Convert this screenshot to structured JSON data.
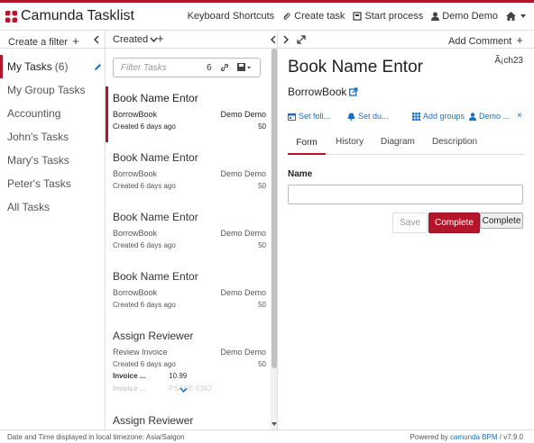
{
  "app": {
    "title": "Camunda Tasklist"
  },
  "nav": {
    "keyboard_shortcuts": "Keyboard Shortcuts",
    "create_task": "Create task",
    "start_process": "Start process",
    "user": "Demo Demo"
  },
  "filters": {
    "create_label": "Create a filter",
    "items": [
      {
        "label": "My Tasks",
        "count": "(6)"
      },
      {
        "label": "My Group Tasks"
      },
      {
        "label": "Accounting"
      },
      {
        "label": "John's Tasks"
      },
      {
        "label": "Mary's Tasks"
      },
      {
        "label": "Peter's Tasks"
      },
      {
        "label": "All Tasks"
      }
    ]
  },
  "list": {
    "sort_label": "Created",
    "search_placeholder": "Filter Tasks",
    "search_count": "6",
    "tasks": [
      {
        "name": "Book Name Entor",
        "process": "BorrowBook",
        "assignee": "Demo Demo",
        "created": "Created 6 days ago",
        "priority": "50"
      },
      {
        "name": "Book Name Entor",
        "process": "BorrowBook",
        "assignee": "Demo Demo",
        "created": "Created 6 days ago",
        "priority": "50"
      },
      {
        "name": "Book Name Entor",
        "process": "BorrowBook",
        "assignee": "Demo Demo",
        "created": "Created 6 days ago",
        "priority": "50"
      },
      {
        "name": "Book Name Entor",
        "process": "BorrowBook",
        "assignee": "Demo Demo",
        "created": "Created 6 days ago",
        "priority": "50"
      },
      {
        "name": "Assign Reviewer",
        "process": "Review Invoice",
        "assignee": "Demo Demo",
        "created": "Created 6 days ago",
        "priority": "50",
        "vars": [
          {
            "name": "Invoice ...",
            "value": "10.99"
          },
          {
            "name": "Invoice ...",
            "value": "PSACE-5342"
          }
        ]
      },
      {
        "name": "Assign Reviewer"
      }
    ]
  },
  "detail": {
    "add_comment": "Add Comment",
    "title": "Book Name Entor",
    "title_right": "Ã¡ch23",
    "process": "BorrowBook",
    "actions": {
      "follow": "Set foll...",
      "due": "Set du...",
      "groups": "Add groups",
      "assignee": "Demo ..."
    },
    "tabs": [
      "Form",
      "History",
      "Diagram",
      "Description"
    ],
    "form": {
      "field_label": "Name",
      "field_value": "",
      "save": "Save",
      "complete": "Complete",
      "complete2": "Complete"
    }
  },
  "footer": {
    "timezone_text": "Date and Time displayed in local timezone: Asia/Saigon",
    "powered_prefix": "Powered by",
    "powered_link": "camunda BPM",
    "version": "/ v7.9.0"
  },
  "colors": {
    "accent": "#b5152b",
    "link": "#1a6fc2"
  }
}
